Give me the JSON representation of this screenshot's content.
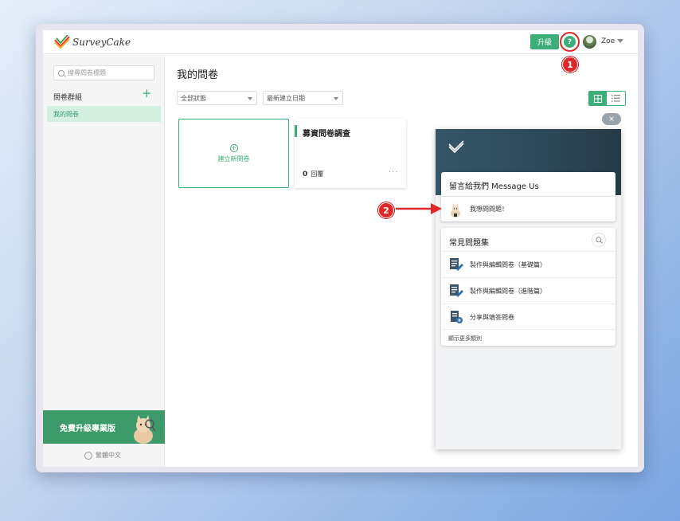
{
  "header": {
    "logo_text": "SurveyCake",
    "upgrade_label": "升級",
    "help_icon_glyph": "?",
    "user_name": "Zoe"
  },
  "callouts": {
    "one": "1",
    "two": "2"
  },
  "sidebar": {
    "search_placeholder": "搜尋問卷標題",
    "group_label": "問卷群組",
    "add_glyph": "+",
    "items": [
      {
        "label": "我的問卷"
      }
    ],
    "promo_label": "免費升級專業版",
    "language": "繁體中文"
  },
  "main": {
    "title": "我的問卷",
    "filters": {
      "status": "全部狀態",
      "sort": "最新建立日期"
    },
    "new_survey_label": "建立新問卷",
    "surveys": [
      {
        "title": "募資問卷調查",
        "responses": "0",
        "responses_label": "回覆",
        "more": "···"
      }
    ]
  },
  "help_panel": {
    "close_glyph": "×",
    "message_title": "留言給我們 Message Us",
    "message_item": "我想問問題！",
    "faq_title": "常見問題集",
    "faq_items": [
      {
        "label": "製作與編輯問卷（基礎篇）"
      },
      {
        "label": "製作與編輯問卷（進階篇）"
      },
      {
        "label": "分享與填答問卷"
      }
    ],
    "show_more": "顯示更多類別"
  },
  "colors": {
    "brand_green": "#3cae78",
    "callout_red": "#e0282a",
    "panel_header": "#2d4a5c"
  }
}
